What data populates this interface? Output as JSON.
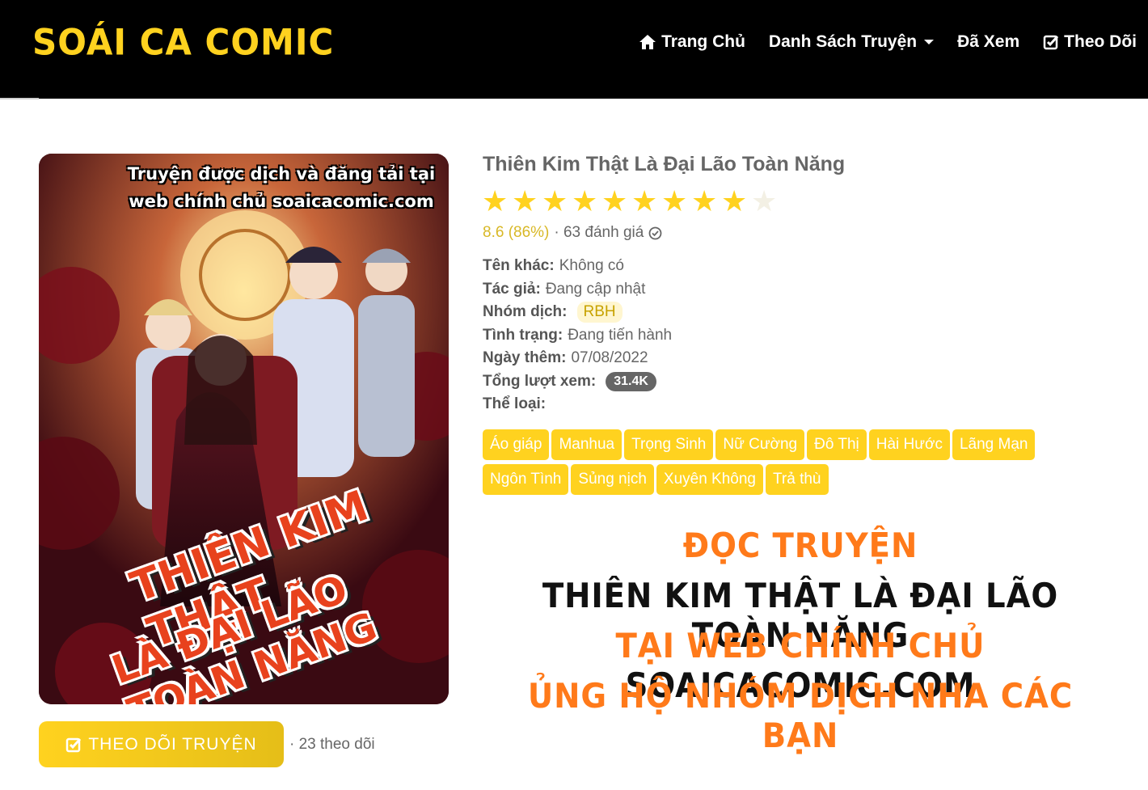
{
  "header": {
    "logo": "SOÁI CA COMIC",
    "nav": [
      {
        "label": "Trang Chủ",
        "icon": "home-icon"
      },
      {
        "label": "Danh Sách Truyện",
        "icon": "caret-down-icon"
      },
      {
        "label": "Đã Xem"
      },
      {
        "label": "Theo Dõi",
        "icon": "check-square-icon"
      }
    ]
  },
  "cover": {
    "top_line1": "Truyện được dịch và đăng tải tại",
    "top_line2": "web chính chủ soaicacomic.com",
    "title_line1": "THIÊN KIM THẬT",
    "title_line2": "LÀ ĐẠI LÃO TOÀN NĂNG"
  },
  "follow": {
    "button_label": "THEO DÕI TRUYỆN",
    "count": "· 23 theo dõi"
  },
  "comic": {
    "title": "Thiên Kim Thật Là Đại Lão Toàn Năng",
    "rating_fraction": 0.86,
    "rating_score": "8.6 (86%)",
    "rating_count": "· 63 đánh giá",
    "meta": {
      "alt_name_label": "Tên khác:",
      "alt_name": "Không có",
      "author_label": "Tác giả:",
      "author": "Đang cập nhật",
      "group_label": "Nhóm dịch:",
      "group": "RBH",
      "status_label": "Tình trạng:",
      "status": "Đang tiến hành",
      "date_label": "Ngày thêm:",
      "date": "07/08/2022",
      "views_label": "Tổng lượt xem:",
      "views": "31.4K",
      "genre_label": "Thể loại:"
    },
    "tags": [
      "Áo giáp",
      "Manhua",
      "Trọng Sinh",
      "Nữ Cường",
      "Đô Thị",
      "Hài Hước",
      "Lãng Mạn",
      "Ngôn Tình",
      "Sủng nịch",
      "Xuyên Không",
      "Trả thù"
    ]
  },
  "promo": {
    "line1": "ĐỌC TRUYỆN",
    "line2": "THIÊN KIM THẬT LÀ ĐẠI LÃO TOÀN NĂNG",
    "line3_a": "TẠI WEB CHÍNH CHỦ",
    "line3_b": "SOAICACOMIC.COM",
    "line4": "ỦNG HỘ NHÓM DỊCH NHA CÁC BẠN"
  },
  "colors": {
    "accent": "#ffd21f",
    "header_bg": "#000000",
    "promo_orange": "#ff7a1a"
  }
}
